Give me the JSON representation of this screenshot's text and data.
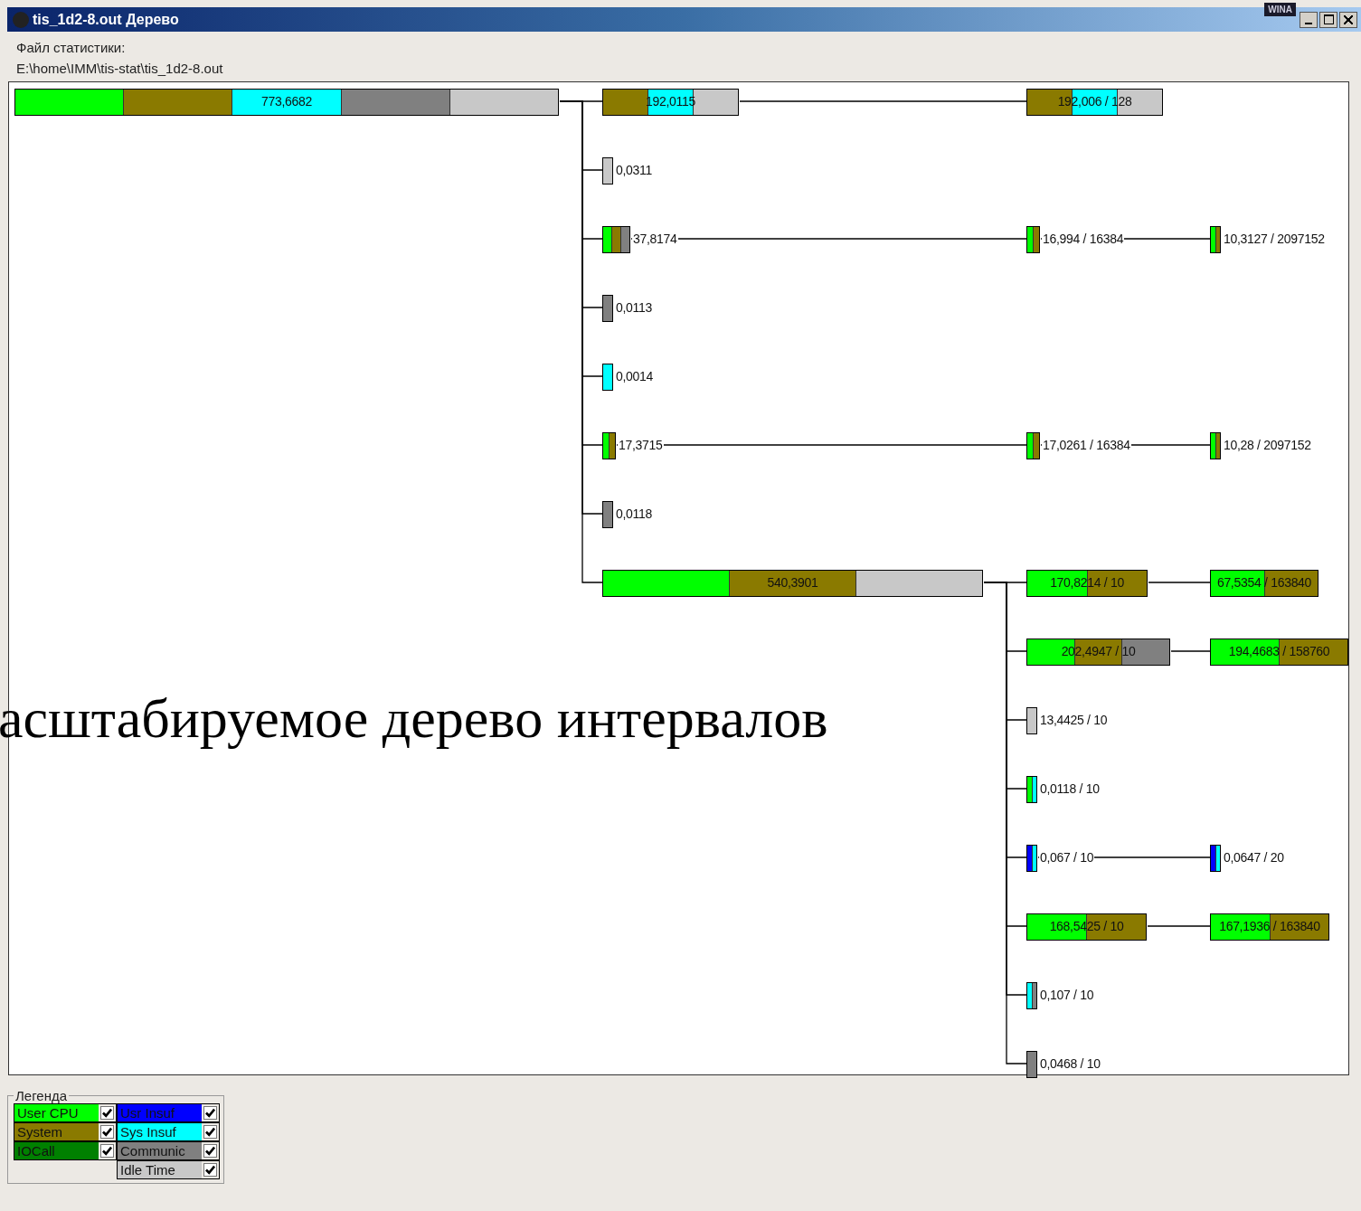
{
  "window": {
    "title": "tis_1d2-8.out Дерево",
    "tray_label": "WINA"
  },
  "file_label": "Файл статистики:",
  "file_path": "E:\\home\\IMM\\tis-stat\\tis_1d2-8.out",
  "tree": {
    "label": "773,6682",
    "segments": [
      {
        "kind": "user"
      },
      {
        "kind": "system"
      },
      {
        "kind": "sys_insuf"
      },
      {
        "kind": "communic"
      },
      {
        "kind": "idle"
      }
    ],
    "children": [
      {
        "label": "192,0115",
        "segments": [
          {
            "kind": "system"
          },
          {
            "kind": "sys_insuf"
          },
          {
            "kind": "idle"
          }
        ],
        "children": [
          {
            "label": "192,006 / 128",
            "segments": [
              {
                "kind": "system"
              },
              {
                "kind": "sys_insuf"
              },
              {
                "kind": "idle"
              }
            ]
          }
        ]
      },
      {
        "label": "0,0311",
        "segments": [
          {
            "kind": "idle"
          }
        ]
      },
      {
        "label": "37,8174",
        "segments": [
          {
            "kind": "user"
          },
          {
            "kind": "system"
          },
          {
            "kind": "communic"
          }
        ],
        "children": [
          {
            "label": "16,994 / 16384",
            "segments": [
              {
                "kind": "user"
              },
              {
                "kind": "system"
              }
            ],
            "children": [
              {
                "label": "10,3127 / 2097152",
                "segments": [
                  {
                    "kind": "user"
                  },
                  {
                    "kind": "system"
                  }
                ]
              }
            ]
          }
        ]
      },
      {
        "label": "0,0113",
        "segments": [
          {
            "kind": "communic"
          }
        ]
      },
      {
        "label": "0,0014",
        "segments": [
          {
            "kind": "sys_insuf"
          }
        ]
      },
      {
        "label": "17,3715",
        "segments": [
          {
            "kind": "user"
          },
          {
            "kind": "system"
          }
        ],
        "children": [
          {
            "label": "17,0261 / 16384",
            "segments": [
              {
                "kind": "user"
              },
              {
                "kind": "system"
              }
            ],
            "children": [
              {
                "label": "10,28 / 2097152",
                "segments": [
                  {
                    "kind": "user"
                  },
                  {
                    "kind": "system"
                  }
                ]
              }
            ]
          }
        ]
      },
      {
        "label": "0,0118",
        "segments": [
          {
            "kind": "communic"
          }
        ]
      },
      {
        "label": "540,3901",
        "segments": [
          {
            "kind": "user"
          },
          {
            "kind": "system"
          },
          {
            "kind": "idle"
          }
        ],
        "children": [
          {
            "label": "170,8214 / 10",
            "segments": [
              {
                "kind": "user"
              },
              {
                "kind": "system"
              }
            ],
            "children": [
              {
                "label": "67,5354 / 163840",
                "segments": [
                  {
                    "kind": "user"
                  },
                  {
                    "kind": "system"
                  }
                ]
              }
            ]
          },
          {
            "label": "202,4947 / 10",
            "segments": [
              {
                "kind": "user"
              },
              {
                "kind": "system"
              },
              {
                "kind": "communic"
              }
            ],
            "children": [
              {
                "label": "194,4683 / 158760",
                "segments": [
                  {
                    "kind": "user"
                  },
                  {
                    "kind": "system"
                  }
                ]
              }
            ]
          },
          {
            "label": "13,4425 / 10",
            "segments": [
              {
                "kind": "idle"
              }
            ]
          },
          {
            "label": "0,0118 / 10",
            "segments": [
              {
                "kind": "user"
              },
              {
                "kind": "sys_insuf"
              }
            ]
          },
          {
            "label": "0,067 / 10",
            "segments": [
              {
                "kind": "usr_insuf"
              },
              {
                "kind": "sys_insuf"
              }
            ],
            "children": [
              {
                "label": "0,0647 / 20",
                "segments": [
                  {
                    "kind": "usr_insuf"
                  },
                  {
                    "kind": "sys_insuf"
                  }
                ]
              }
            ]
          },
          {
            "label": "168,5425 / 10",
            "segments": [
              {
                "kind": "user"
              },
              {
                "kind": "system"
              }
            ],
            "children": [
              {
                "label": "167,1936 / 163840",
                "segments": [
                  {
                    "kind": "user"
                  },
                  {
                    "kind": "system"
                  }
                ]
              }
            ]
          },
          {
            "label": "0,107 / 10",
            "segments": [
              {
                "kind": "sys_insuf"
              },
              {
                "kind": "communic"
              }
            ]
          },
          {
            "label": "0,0468 / 10",
            "segments": [
              {
                "kind": "communic"
              }
            ]
          }
        ]
      }
    ]
  },
  "caption": "асштабируемое дерево интервалов",
  "legend": {
    "title": "Легенда",
    "columns": [
      [
        {
          "kind": "user",
          "label": "User CPU",
          "color": "#00ff00",
          "checked": true
        },
        {
          "kind": "system",
          "label": "System",
          "color": "#8a7a00",
          "checked": true
        },
        {
          "kind": "iocall",
          "label": "IOCall",
          "color": "#008000",
          "checked": true
        }
      ],
      [
        {
          "kind": "usr_insuf",
          "label": "Usr Insuf",
          "color": "#0000ff",
          "checked": true
        },
        {
          "kind": "sys_insuf",
          "label": "Sys Insuf",
          "color": "#00ffff",
          "checked": true
        },
        {
          "kind": "communic",
          "label": "Communic",
          "color": "#808080",
          "checked": true
        },
        {
          "kind": "idle",
          "label": "Idle Time",
          "color": "#c8c8c8",
          "checked": true
        }
      ]
    ]
  }
}
